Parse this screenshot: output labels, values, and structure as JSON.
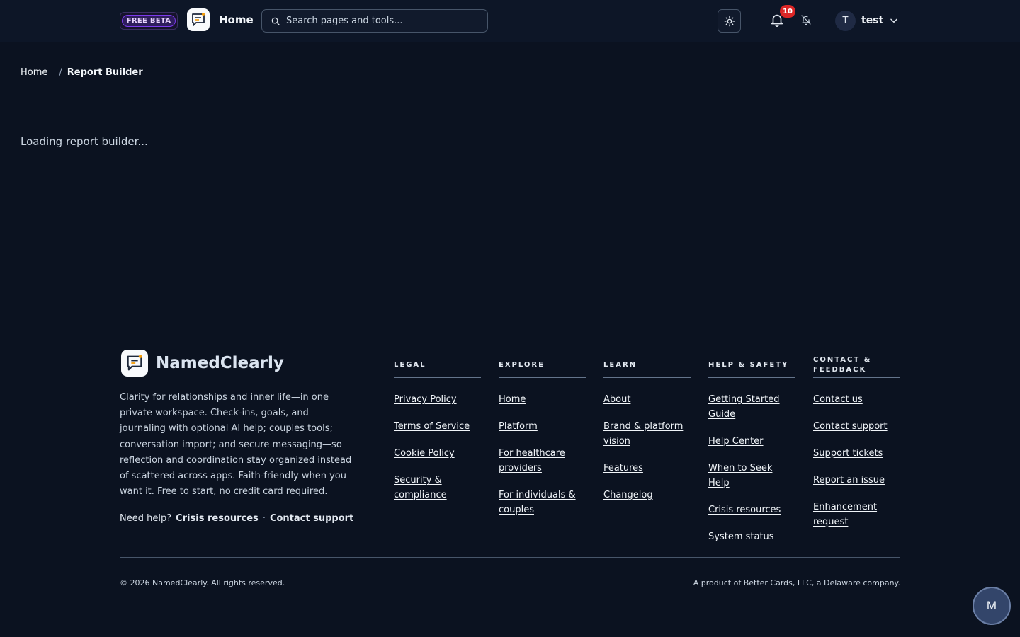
{
  "header": {
    "beta_badge": "FREE BETA",
    "home_label": "Home",
    "search_placeholder": "Search pages and tools...",
    "notification_count": "10",
    "user_initial": "T",
    "user_name": "test"
  },
  "breadcrumb": {
    "home": "Home",
    "separator": "/",
    "current": "Report Builder"
  },
  "main": {
    "loading_text": "Loading report builder..."
  },
  "footer": {
    "brand_name": "NamedClearly",
    "tagline": "Clarity for relationships and inner life—in one private workspace. Check-ins, goals, and journaling with optional AI help; couples tools; conversation import; and secure messaging—so reflection and coordination stay organized instead of scattered across apps. Faith-friendly when you want it. Free to start, no credit card required.",
    "need_help": {
      "label": "Need help?",
      "crisis": "Crisis resources",
      "dot": "·",
      "contact": "Contact support"
    },
    "columns": [
      {
        "heading": "LEGAL",
        "links": [
          "Privacy Policy",
          "Terms of Service",
          "Cookie Policy",
          "Security & compliance"
        ]
      },
      {
        "heading": "EXPLORE",
        "links": [
          "Home",
          "Platform",
          "For healthcare providers",
          "For individuals & couples"
        ]
      },
      {
        "heading": "LEARN",
        "links": [
          "About",
          "Brand & platform vision",
          "Features",
          "Changelog"
        ]
      },
      {
        "heading": "HELP & SAFETY",
        "links": [
          "Getting Started Guide",
          "Help Center",
          "When to Seek Help",
          "Crisis resources",
          "System status"
        ]
      },
      {
        "heading": "CONTACT & FEEDBACK",
        "links": [
          "Contact us",
          "Contact support",
          "Support tickets",
          "Report an issue",
          "Enhancement request"
        ]
      }
    ],
    "copyright": "© 2026 NamedClearly. All rights reserved.",
    "product_of": "A product of Better Cards, LLC, a Delaware company."
  },
  "fab": {
    "label": "M"
  },
  "icons": {
    "logo": "chat-bubble-logo-icon",
    "search": "search-icon",
    "theme": "sun-icon",
    "notifications": "bell-icon",
    "mute": "bell-off-icon",
    "menu": "chevron-down-icon"
  },
  "colors": {
    "background": "#0b1220",
    "badge_red": "#dc2626",
    "beta_purple": "#7c3aed",
    "logo_accent": "#f59e0b"
  }
}
